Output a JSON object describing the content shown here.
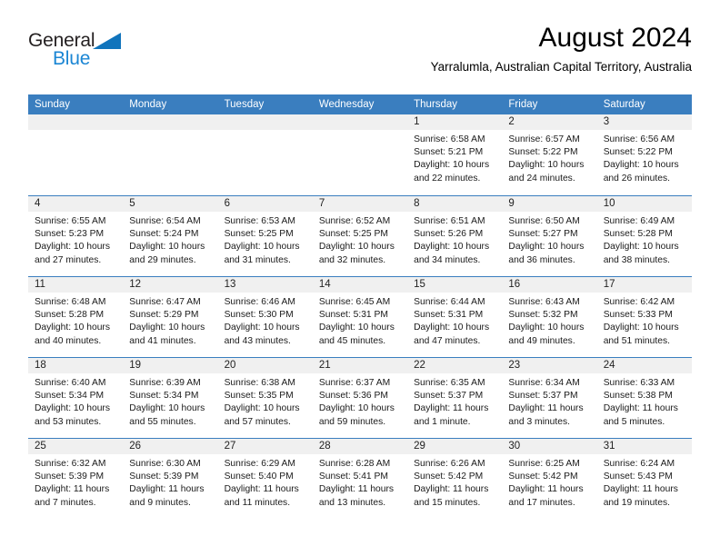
{
  "brand": {
    "name_top": "General",
    "name_bottom": "Blue",
    "top_color": "#231f20",
    "bottom_color": "#1b86d4",
    "triangle_color": "#1074bc"
  },
  "header": {
    "title": "August 2024",
    "subtitle": "Yarralumla, Australian Capital Territory, Australia"
  },
  "theme": {
    "header_band": "#3a7ebf",
    "day_strip": "#f0f0f0",
    "row_divider": "#3a7ebf"
  },
  "weekdays": [
    "Sunday",
    "Monday",
    "Tuesday",
    "Wednesday",
    "Thursday",
    "Friday",
    "Saturday"
  ],
  "weeks": [
    [
      {
        "date": "",
        "sunrise": "",
        "sunset": "",
        "daylight_line1": "",
        "daylight_line2": ""
      },
      {
        "date": "",
        "sunrise": "",
        "sunset": "",
        "daylight_line1": "",
        "daylight_line2": ""
      },
      {
        "date": "",
        "sunrise": "",
        "sunset": "",
        "daylight_line1": "",
        "daylight_line2": ""
      },
      {
        "date": "",
        "sunrise": "",
        "sunset": "",
        "daylight_line1": "",
        "daylight_line2": ""
      },
      {
        "date": "1",
        "sunrise": "Sunrise: 6:58 AM",
        "sunset": "Sunset: 5:21 PM",
        "daylight_line1": "Daylight: 10 hours",
        "daylight_line2": "and 22 minutes."
      },
      {
        "date": "2",
        "sunrise": "Sunrise: 6:57 AM",
        "sunset": "Sunset: 5:22 PM",
        "daylight_line1": "Daylight: 10 hours",
        "daylight_line2": "and 24 minutes."
      },
      {
        "date": "3",
        "sunrise": "Sunrise: 6:56 AM",
        "sunset": "Sunset: 5:22 PM",
        "daylight_line1": "Daylight: 10 hours",
        "daylight_line2": "and 26 minutes."
      }
    ],
    [
      {
        "date": "4",
        "sunrise": "Sunrise: 6:55 AM",
        "sunset": "Sunset: 5:23 PM",
        "daylight_line1": "Daylight: 10 hours",
        "daylight_line2": "and 27 minutes."
      },
      {
        "date": "5",
        "sunrise": "Sunrise: 6:54 AM",
        "sunset": "Sunset: 5:24 PM",
        "daylight_line1": "Daylight: 10 hours",
        "daylight_line2": "and 29 minutes."
      },
      {
        "date": "6",
        "sunrise": "Sunrise: 6:53 AM",
        "sunset": "Sunset: 5:25 PM",
        "daylight_line1": "Daylight: 10 hours",
        "daylight_line2": "and 31 minutes."
      },
      {
        "date": "7",
        "sunrise": "Sunrise: 6:52 AM",
        "sunset": "Sunset: 5:25 PM",
        "daylight_line1": "Daylight: 10 hours",
        "daylight_line2": "and 32 minutes."
      },
      {
        "date": "8",
        "sunrise": "Sunrise: 6:51 AM",
        "sunset": "Sunset: 5:26 PM",
        "daylight_line1": "Daylight: 10 hours",
        "daylight_line2": "and 34 minutes."
      },
      {
        "date": "9",
        "sunrise": "Sunrise: 6:50 AM",
        "sunset": "Sunset: 5:27 PM",
        "daylight_line1": "Daylight: 10 hours",
        "daylight_line2": "and 36 minutes."
      },
      {
        "date": "10",
        "sunrise": "Sunrise: 6:49 AM",
        "sunset": "Sunset: 5:28 PM",
        "daylight_line1": "Daylight: 10 hours",
        "daylight_line2": "and 38 minutes."
      }
    ],
    [
      {
        "date": "11",
        "sunrise": "Sunrise: 6:48 AM",
        "sunset": "Sunset: 5:28 PM",
        "daylight_line1": "Daylight: 10 hours",
        "daylight_line2": "and 40 minutes."
      },
      {
        "date": "12",
        "sunrise": "Sunrise: 6:47 AM",
        "sunset": "Sunset: 5:29 PM",
        "daylight_line1": "Daylight: 10 hours",
        "daylight_line2": "and 41 minutes."
      },
      {
        "date": "13",
        "sunrise": "Sunrise: 6:46 AM",
        "sunset": "Sunset: 5:30 PM",
        "daylight_line1": "Daylight: 10 hours",
        "daylight_line2": "and 43 minutes."
      },
      {
        "date": "14",
        "sunrise": "Sunrise: 6:45 AM",
        "sunset": "Sunset: 5:31 PM",
        "daylight_line1": "Daylight: 10 hours",
        "daylight_line2": "and 45 minutes."
      },
      {
        "date": "15",
        "sunrise": "Sunrise: 6:44 AM",
        "sunset": "Sunset: 5:31 PM",
        "daylight_line1": "Daylight: 10 hours",
        "daylight_line2": "and 47 minutes."
      },
      {
        "date": "16",
        "sunrise": "Sunrise: 6:43 AM",
        "sunset": "Sunset: 5:32 PM",
        "daylight_line1": "Daylight: 10 hours",
        "daylight_line2": "and 49 minutes."
      },
      {
        "date": "17",
        "sunrise": "Sunrise: 6:42 AM",
        "sunset": "Sunset: 5:33 PM",
        "daylight_line1": "Daylight: 10 hours",
        "daylight_line2": "and 51 minutes."
      }
    ],
    [
      {
        "date": "18",
        "sunrise": "Sunrise: 6:40 AM",
        "sunset": "Sunset: 5:34 PM",
        "daylight_line1": "Daylight: 10 hours",
        "daylight_line2": "and 53 minutes."
      },
      {
        "date": "19",
        "sunrise": "Sunrise: 6:39 AM",
        "sunset": "Sunset: 5:34 PM",
        "daylight_line1": "Daylight: 10 hours",
        "daylight_line2": "and 55 minutes."
      },
      {
        "date": "20",
        "sunrise": "Sunrise: 6:38 AM",
        "sunset": "Sunset: 5:35 PM",
        "daylight_line1": "Daylight: 10 hours",
        "daylight_line2": "and 57 minutes."
      },
      {
        "date": "21",
        "sunrise": "Sunrise: 6:37 AM",
        "sunset": "Sunset: 5:36 PM",
        "daylight_line1": "Daylight: 10 hours",
        "daylight_line2": "and 59 minutes."
      },
      {
        "date": "22",
        "sunrise": "Sunrise: 6:35 AM",
        "sunset": "Sunset: 5:37 PM",
        "daylight_line1": "Daylight: 11 hours",
        "daylight_line2": "and 1 minute."
      },
      {
        "date": "23",
        "sunrise": "Sunrise: 6:34 AM",
        "sunset": "Sunset: 5:37 PM",
        "daylight_line1": "Daylight: 11 hours",
        "daylight_line2": "and 3 minutes."
      },
      {
        "date": "24",
        "sunrise": "Sunrise: 6:33 AM",
        "sunset": "Sunset: 5:38 PM",
        "daylight_line1": "Daylight: 11 hours",
        "daylight_line2": "and 5 minutes."
      }
    ],
    [
      {
        "date": "25",
        "sunrise": "Sunrise: 6:32 AM",
        "sunset": "Sunset: 5:39 PM",
        "daylight_line1": "Daylight: 11 hours",
        "daylight_line2": "and 7 minutes."
      },
      {
        "date": "26",
        "sunrise": "Sunrise: 6:30 AM",
        "sunset": "Sunset: 5:39 PM",
        "daylight_line1": "Daylight: 11 hours",
        "daylight_line2": "and 9 minutes."
      },
      {
        "date": "27",
        "sunrise": "Sunrise: 6:29 AM",
        "sunset": "Sunset: 5:40 PM",
        "daylight_line1": "Daylight: 11 hours",
        "daylight_line2": "and 11 minutes."
      },
      {
        "date": "28",
        "sunrise": "Sunrise: 6:28 AM",
        "sunset": "Sunset: 5:41 PM",
        "daylight_line1": "Daylight: 11 hours",
        "daylight_line2": "and 13 minutes."
      },
      {
        "date": "29",
        "sunrise": "Sunrise: 6:26 AM",
        "sunset": "Sunset: 5:42 PM",
        "daylight_line1": "Daylight: 11 hours",
        "daylight_line2": "and 15 minutes."
      },
      {
        "date": "30",
        "sunrise": "Sunrise: 6:25 AM",
        "sunset": "Sunset: 5:42 PM",
        "daylight_line1": "Daylight: 11 hours",
        "daylight_line2": "and 17 minutes."
      },
      {
        "date": "31",
        "sunrise": "Sunrise: 6:24 AM",
        "sunset": "Sunset: 5:43 PM",
        "daylight_line1": "Daylight: 11 hours",
        "daylight_line2": "and 19 minutes."
      }
    ]
  ]
}
